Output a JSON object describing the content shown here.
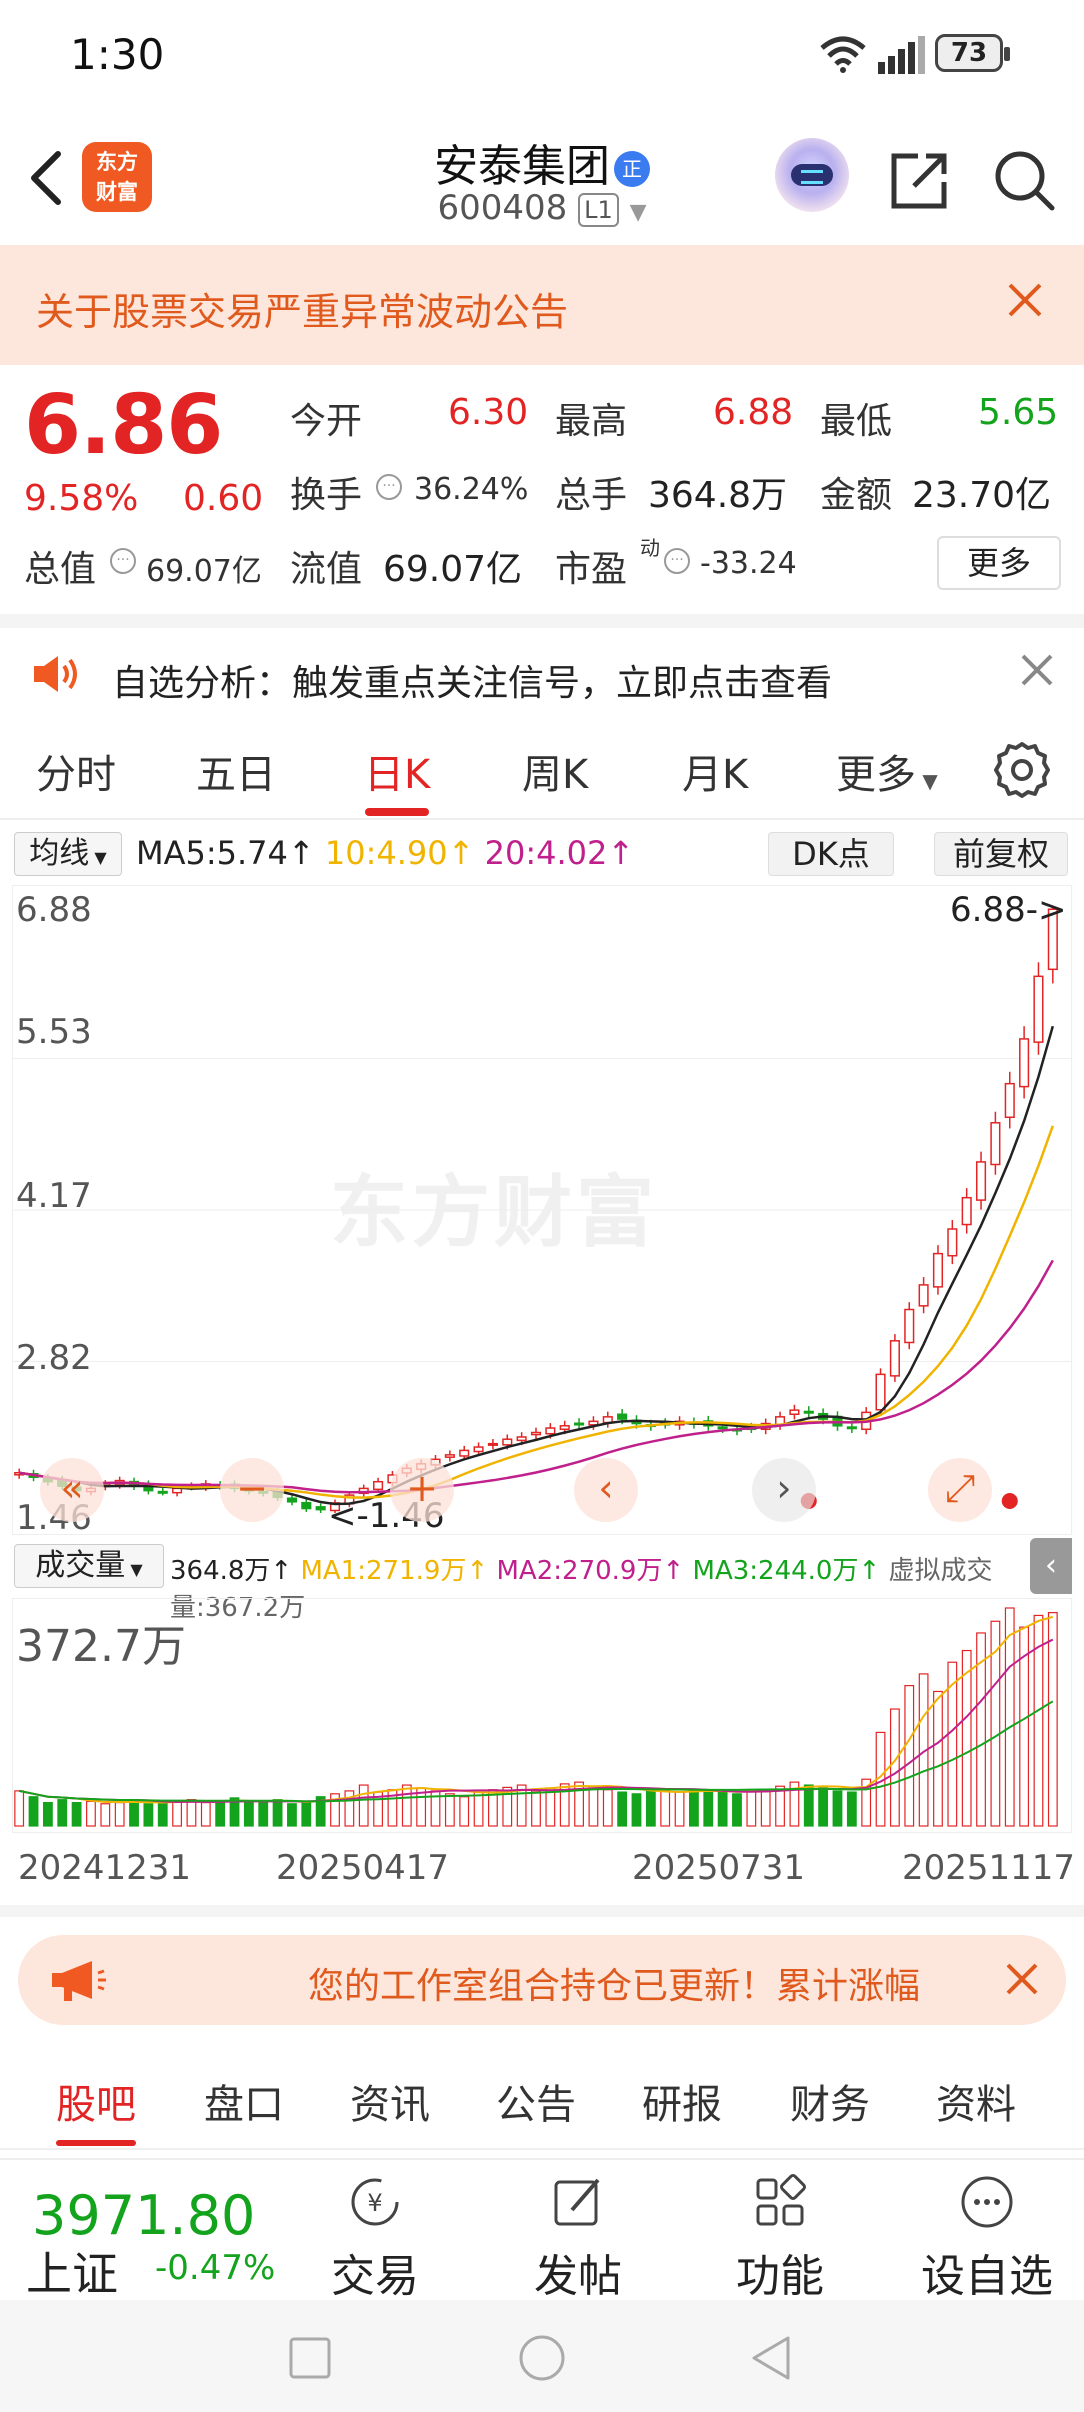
{
  "status_bar": {
    "time": "1:30",
    "battery": "73"
  },
  "header": {
    "logo_line1": "东方",
    "logo_line2": "财富",
    "stock_name": "安泰集团",
    "badge": "正",
    "stock_code": "600408",
    "level": "L1"
  },
  "notice": {
    "text": "关于股票交易严重异常波动公告"
  },
  "quote": {
    "price": "6.86",
    "change_pct": "9.58%",
    "change": "0.60",
    "open_label": "今开",
    "open": "6.30",
    "high_label": "最高",
    "high": "6.88",
    "low_label": "最低",
    "low": "5.65",
    "turnover_label": "换手",
    "turnover": "36.24%",
    "volume_label": "总手",
    "volume": "364.8万",
    "amount_label": "金额",
    "amount": "23.70亿",
    "mcap_label": "总值",
    "mcap": "69.07亿",
    "float_label": "流值",
    "float": "69.07亿",
    "pe_label": "市盈",
    "pe_sup": "动",
    "pe": "-33.24",
    "more": "更多"
  },
  "analysis": {
    "text": "自选分析：触发重点关注信号，立即点击查看"
  },
  "period_tabs": [
    {
      "label": "分时"
    },
    {
      "label": "五日"
    },
    {
      "label": "日K"
    },
    {
      "label": "周K"
    },
    {
      "label": "月K"
    },
    {
      "label": "更多"
    }
  ],
  "ma_legend": {
    "select": "均线",
    "ma5": "MA5:5.74↑",
    "ma10": "10:4.90↑",
    "ma20": "20:4.02↑",
    "dk": "DK点",
    "fq": "前复权"
  },
  "chart": {
    "y_labels": [
      "6.88",
      "5.53",
      "4.17",
      "2.82",
      "1.46"
    ],
    "max_marker": "6.88->",
    "min_marker": "<-1.46",
    "watermark": "东方财富"
  },
  "volume_legend": {
    "select": "成交量",
    "vol": "364.8万↑",
    "ma1": "MA1:271.9万↑",
    "ma2": "MA2:270.9万↑",
    "ma3": "MA3:244.0万↑",
    "virtual": "虚拟成交量:367.2万",
    "max_label": "372.7万"
  },
  "dates": [
    "20241231",
    "20250417",
    "20250731",
    "20251117"
  ],
  "studio_banner": {
    "text": "您的工作室组合持仓已更新！累计涨幅"
  },
  "content_tabs": [
    {
      "label": "股吧"
    },
    {
      "label": "盘口"
    },
    {
      "label": "资讯"
    },
    {
      "label": "公告"
    },
    {
      "label": "研报"
    },
    {
      "label": "财务"
    },
    {
      "label": "资料"
    }
  ],
  "bottom_bar": {
    "index_value": "3971.80",
    "index_name": "上证",
    "index_pct": "-0.47%",
    "trade": "交易",
    "post": "发帖",
    "func": "功能",
    "watch": "设自选"
  },
  "colors": {
    "up": "#e22424",
    "down": "#13a31c",
    "ma5": "#222222",
    "ma10": "#f0b400",
    "ma20": "#c0208c",
    "accent": "#e05a1e"
  },
  "chart_data": {
    "type": "candlestick",
    "x_labels": [
      "20241231",
      "20250417",
      "20250731",
      "20251117"
    ],
    "ylim": [
      1.46,
      6.88
    ],
    "close": [
      1.82,
      1.78,
      1.74,
      1.7,
      1.66,
      1.68,
      1.72,
      1.75,
      1.7,
      1.66,
      1.65,
      1.68,
      1.7,
      1.72,
      1.7,
      1.68,
      1.66,
      1.64,
      1.6,
      1.56,
      1.5,
      1.49,
      1.55,
      1.62,
      1.68,
      1.74,
      1.8,
      1.86,
      1.9,
      1.94,
      1.98,
      2.02,
      2.05,
      2.08,
      2.12,
      2.14,
      2.18,
      2.22,
      2.24,
      2.26,
      2.28,
      2.32,
      2.3,
      2.26,
      2.24,
      2.26,
      2.28,
      2.26,
      2.24,
      2.22,
      2.2,
      2.22,
      2.26,
      2.32,
      2.38,
      2.36,
      2.3,
      2.24,
      2.22,
      2.36,
      2.7,
      3.0,
      3.28,
      3.5,
      3.78,
      4.0,
      4.28,
      4.6,
      4.95,
      5.3,
      5.7,
      6.26,
      6.86
    ],
    "volume_wan": [
      60,
      50,
      40,
      45,
      40,
      42,
      38,
      40,
      45,
      38,
      40,
      42,
      45,
      40,
      42,
      48,
      40,
      42,
      45,
      38,
      40,
      50,
      55,
      60,
      70,
      58,
      62,
      70,
      65,
      60,
      55,
      50,
      58,
      62,
      66,
      70,
      60,
      65,
      72,
      75,
      68,
      62,
      58,
      55,
      60,
      60,
      58,
      62,
      60,
      58,
      55,
      60,
      62,
      68,
      75,
      70,
      65,
      60,
      58,
      80,
      160,
      200,
      240,
      260,
      230,
      280,
      300,
      330,
      350,
      372.7,
      340,
      360,
      364.8
    ]
  }
}
